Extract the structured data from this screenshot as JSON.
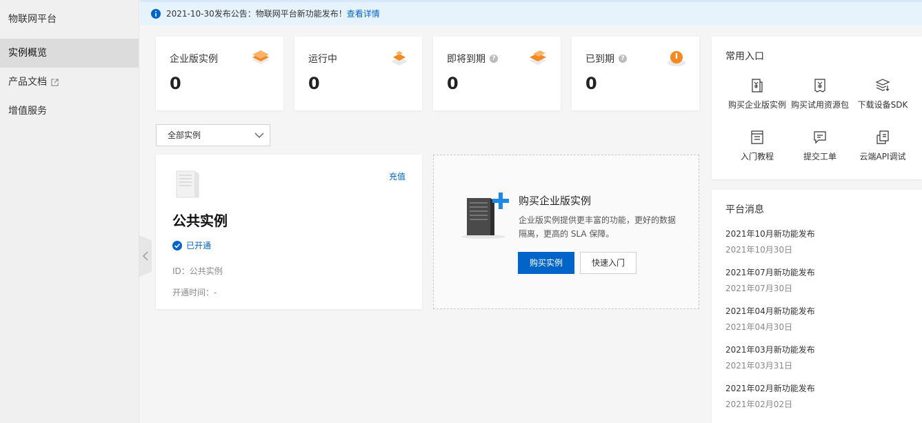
{
  "sidebar": {
    "brand": "物联网平台",
    "items": [
      {
        "label": "实例概览"
      },
      {
        "label": "产品文档"
      },
      {
        "label": "增值服务"
      }
    ]
  },
  "announcement": {
    "text": "2021-10-30发布公告：物联网平台新功能发布！",
    "link": "查看详情"
  },
  "stats": [
    {
      "label": "企业版实例",
      "value": "0"
    },
    {
      "label": "运行中",
      "value": "0"
    },
    {
      "label": "即将到期",
      "value": "0"
    },
    {
      "label": "已到期",
      "value": "0"
    }
  ],
  "filter": {
    "selected": "全部实例"
  },
  "public_instance": {
    "recharge": "充值",
    "title": "公共实例",
    "status": "已开通",
    "id": "ID：公共实例",
    "open_time": "开通时间：-"
  },
  "buy": {
    "title": "购买企业版实例",
    "desc": "企业版实例提供更丰富的功能，更好的数据隔离，更高的 SLA 保障。",
    "primary": "购买实例",
    "secondary": "快速入门"
  },
  "quick_entries": {
    "title": "常用入口",
    "items": [
      {
        "label": "购买企业版实例",
        "icon": "yuan-doc-icon"
      },
      {
        "label": "购买试用资源包",
        "icon": "yuan-voucher-icon"
      },
      {
        "label": "下载设备SDK",
        "icon": "layers-download-icon"
      },
      {
        "label": "入门教程",
        "icon": "book-icon"
      },
      {
        "label": "提交工单",
        "icon": "chat-icon"
      },
      {
        "label": "云端API调试",
        "icon": "api-debug-icon"
      }
    ]
  },
  "messages": {
    "title": "平台消息",
    "items": [
      {
        "title": "2021年10月新功能发布",
        "date": "2021年10月30日"
      },
      {
        "title": "2021年07月新功能发布",
        "date": "2021年07月30日"
      },
      {
        "title": "2021年04月新功能发布",
        "date": "2021年04月30日"
      },
      {
        "title": "2021年03月新功能发布",
        "date": "2021年03月31日"
      },
      {
        "title": "2021年02月新功能发布",
        "date": "2021年02月02日"
      }
    ]
  },
  "colors": {
    "accent": "#0064c8",
    "orange": "#f5891f"
  }
}
